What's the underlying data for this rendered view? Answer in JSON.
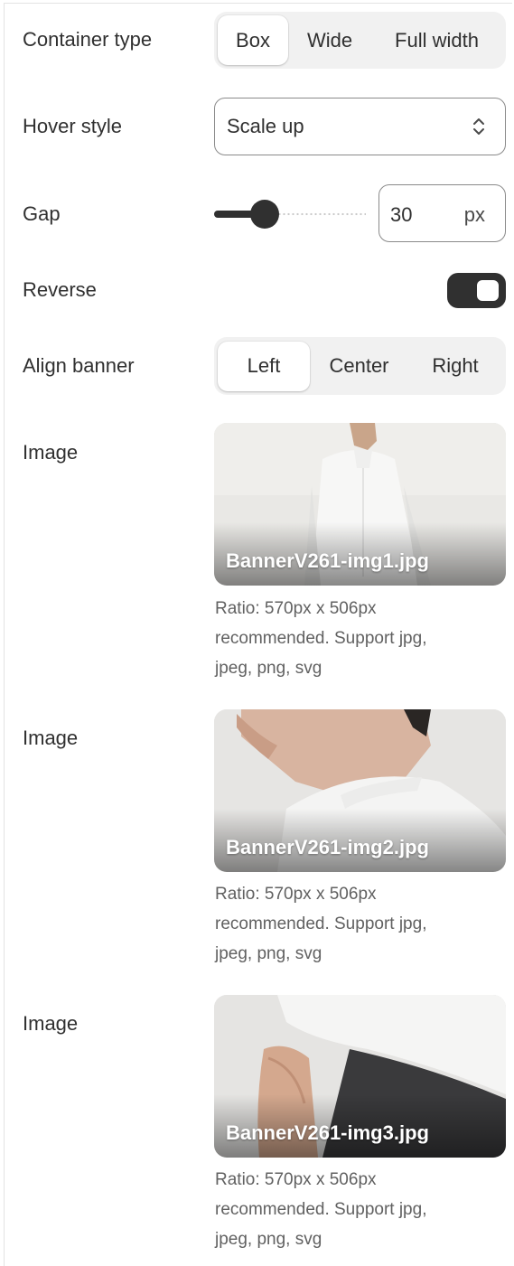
{
  "fields": {
    "container_type": {
      "label": "Container type",
      "options": [
        "Box",
        "Wide",
        "Full width"
      ],
      "selected": "Box"
    },
    "hover_style": {
      "label": "Hover style",
      "value": "Scale up"
    },
    "gap": {
      "label": "Gap",
      "value": "30",
      "unit": "px"
    },
    "reverse": {
      "label": "Reverse",
      "enabled": true
    },
    "align_banner": {
      "label": "Align banner",
      "options": [
        "Left",
        "Center",
        "Right"
      ],
      "selected": "Left"
    }
  },
  "images": [
    {
      "label": "Image",
      "filename": "BannerV261-img1.jpg",
      "help_line1": "Ratio: 570px x 506px",
      "help_line2": "recommended. Support jpg,",
      "help_line3": "jpeg, png, svg"
    },
    {
      "label": "Image",
      "filename": "BannerV261-img2.jpg",
      "help_line1": "Ratio: 570px x 506px",
      "help_line2": "recommended. Support jpg,",
      "help_line3": "jpeg, png, svg"
    },
    {
      "label": "Image",
      "filename": "BannerV261-img3.jpg",
      "help_line1": "Ratio: 570px x 506px",
      "help_line2": "recommended. Support jpg,",
      "help_line3": "jpeg, png, svg"
    }
  ],
  "colors": {
    "text": "#303030",
    "muted": "#616161",
    "segment_bg": "#f1f1f1",
    "control_dark": "#303030",
    "border": "#8a8a8a"
  },
  "icons": {
    "select_chevron": "chevron-up-down-icon"
  }
}
